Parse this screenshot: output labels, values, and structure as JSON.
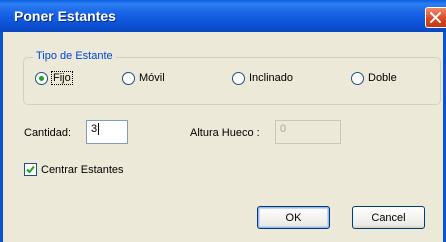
{
  "window": {
    "title": "Poner Estantes",
    "colors": {
      "titlebar": "#0b52d6",
      "face": "#ece9d8",
      "group_legend": "#0046d5",
      "check": "#21a121"
    }
  },
  "titlebar": {
    "close_icon": "close-icon"
  },
  "tipo_group": {
    "legend": "Tipo de Estante",
    "options": [
      {
        "label": "Fijo",
        "checked": true
      },
      {
        "label": "Móvil",
        "checked": false
      },
      {
        "label": "Inclinado",
        "checked": false
      },
      {
        "label": "Doble",
        "checked": false
      }
    ]
  },
  "cantidad": {
    "label": "Cantidad:",
    "value": "3"
  },
  "altura": {
    "label": "Altura Hueco :",
    "value": "0",
    "enabled": false
  },
  "centrar": {
    "label": "Centrar Estantes",
    "checked": true
  },
  "buttons": {
    "ok": "OK",
    "cancel": "Cancel"
  }
}
